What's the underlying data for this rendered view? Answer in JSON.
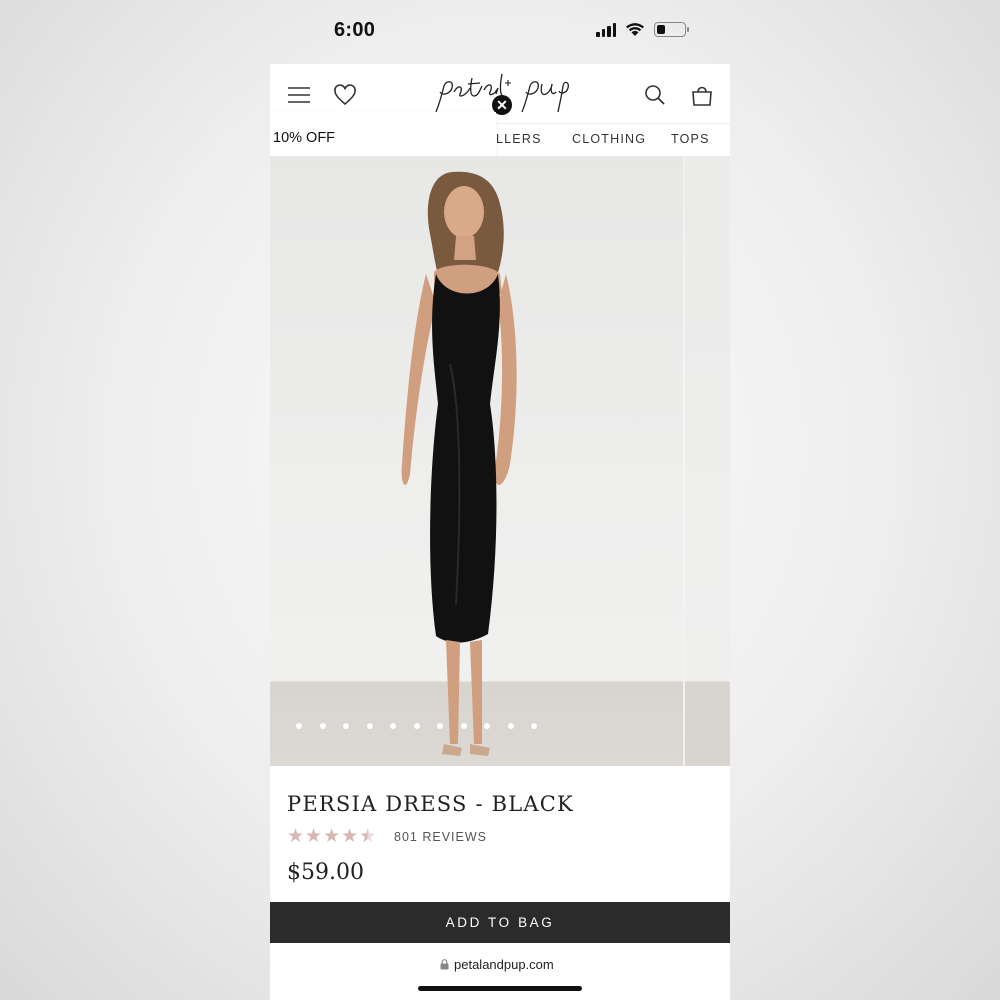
{
  "status": {
    "time": "6:00",
    "battery_level": 0.3
  },
  "header": {
    "logo_text": "petal + pup",
    "icons": [
      "menu-icon",
      "heart-icon",
      "search-icon",
      "bag-icon",
      "close-icon"
    ]
  },
  "promo": {
    "label": "10% OFF"
  },
  "nav": {
    "items": [
      "LLERS",
      "CLOTHING",
      "TOPS"
    ]
  },
  "gallery": {
    "image_count": 11,
    "active_index": 0
  },
  "product": {
    "title": "PERSIA DRESS - BLACK",
    "rating": 4.5,
    "reviews": "801 REVIEWS",
    "price": "$59.00",
    "cta": "ADD TO BAG"
  },
  "browser": {
    "url": "petalandpup.com"
  },
  "colors": {
    "button_bg": "#2b2b2b",
    "star": "#d8b6b2"
  }
}
